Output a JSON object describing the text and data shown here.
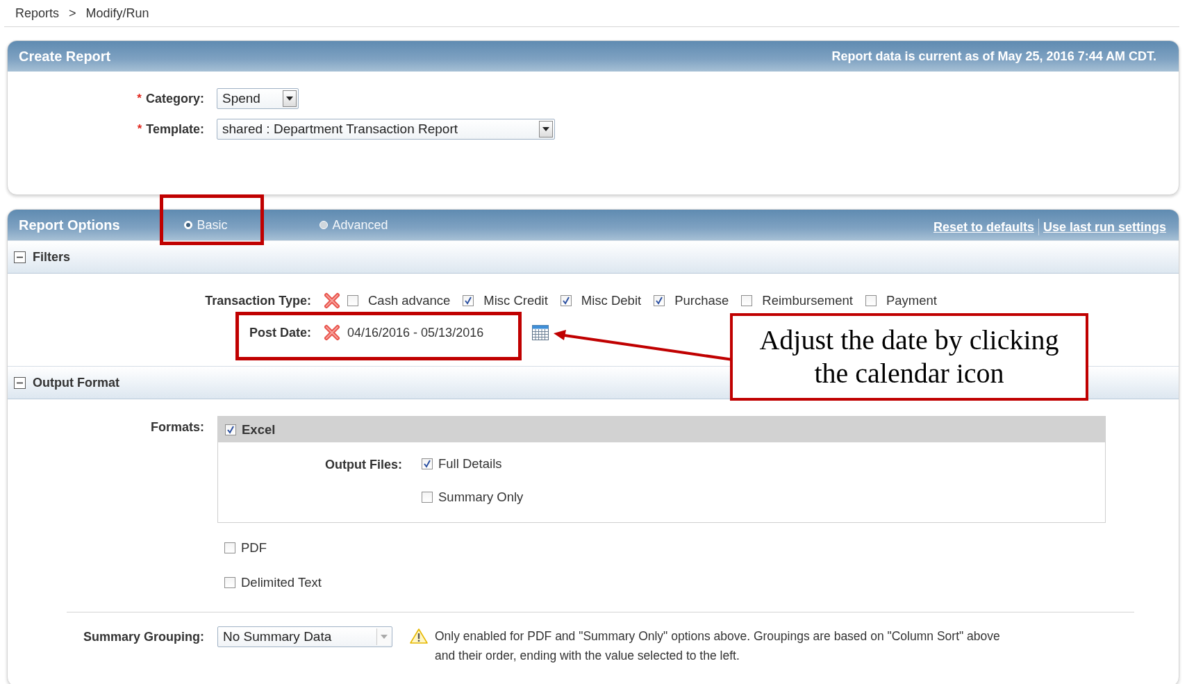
{
  "breadcrumb": {
    "items": [
      "Reports",
      "Modify/Run"
    ],
    "separator": ">"
  },
  "create_report": {
    "title": "Create Report",
    "status": "Report data is current as of May 25, 2016 7:44 AM CDT.",
    "fields": [
      {
        "marker": "*",
        "label": "Category:",
        "value": "Spend",
        "wide": false
      },
      {
        "marker": "*",
        "label": "Template:",
        "value": "shared : Department Transaction Report",
        "wide": true
      }
    ]
  },
  "report_options": {
    "title": "Report Options",
    "modes": [
      {
        "label": "Basic",
        "selected": true,
        "highlighted": true
      },
      {
        "label": "Advanced",
        "selected": false,
        "highlighted": false
      }
    ],
    "links": [
      "Reset to defaults",
      "Use last run settings"
    ]
  },
  "filters": {
    "title": "Filters",
    "expanded": true,
    "transaction_type": {
      "label": "Transaction Type:",
      "options": [
        {
          "label": "Cash advance",
          "checked": false
        },
        {
          "label": "Misc Credit",
          "checked": true
        },
        {
          "label": "Misc Debit",
          "checked": true
        },
        {
          "label": "Purchase",
          "checked": true
        },
        {
          "label": "Reimbursement",
          "checked": false
        },
        {
          "label": "Payment",
          "checked": false
        }
      ]
    },
    "post_date": {
      "label": "Post Date:",
      "value": "04/16/2016 - 05/13/2016",
      "highlighted": true
    }
  },
  "output_format": {
    "title": "Output Format",
    "expanded": true,
    "formats_label": "Formats:",
    "formats": [
      {
        "label": "Excel",
        "checked": true,
        "output_files": {
          "label": "Output Files:",
          "options": [
            {
              "label": "Full Details",
              "checked": true
            },
            {
              "label": "Summary Only",
              "checked": false
            }
          ]
        }
      },
      {
        "label": "PDF",
        "checked": false
      },
      {
        "label": "Delimited Text",
        "checked": false
      }
    ],
    "summary_grouping": {
      "label": "Summary Grouping:",
      "value": "No Summary Data",
      "disabled": true
    },
    "note": "Only enabled for PDF and \"Summary Only\" options above. Groupings are based on \"Column Sort\" above and their order, ending with the value selected to the left."
  },
  "annotation": {
    "text": "Adjust the date by clicking the calendar icon"
  }
}
